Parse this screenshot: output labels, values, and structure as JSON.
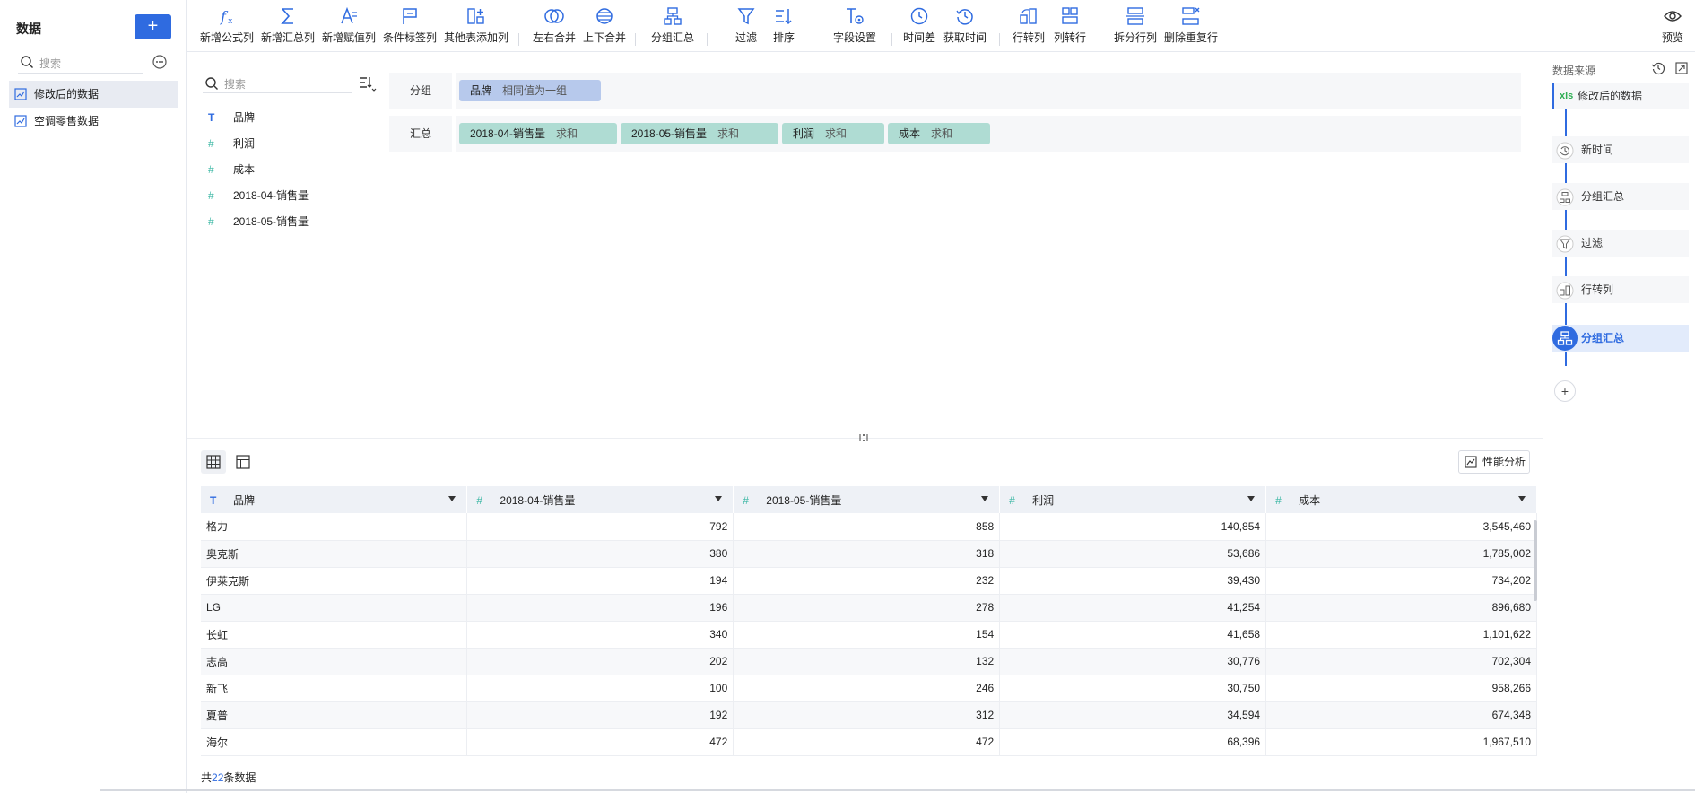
{
  "sidebar": {
    "title": "数据",
    "add_label": "+",
    "search_placeholder": "搜索",
    "items": [
      {
        "label": "修改后的数据",
        "active": true
      },
      {
        "label": "空调零售数据",
        "active": false
      }
    ]
  },
  "toolbar": {
    "buttons": [
      {
        "label": "新增公式列",
        "icon": "formula-icon"
      },
      {
        "label": "新增汇总列",
        "icon": "sigma-icon"
      },
      {
        "label": "新增赋值列",
        "icon": "assign-icon"
      },
      {
        "label": "条件标签列",
        "icon": "flag-icon"
      },
      {
        "label": "其他表添加列",
        "icon": "add-column-icon"
      },
      {
        "label": "左右合并",
        "icon": "merge-lr-icon"
      },
      {
        "label": "上下合并",
        "icon": "merge-ud-icon"
      },
      {
        "label": "分组汇总",
        "icon": "group-summary-icon"
      },
      {
        "label": "过滤",
        "icon": "filter-icon"
      },
      {
        "label": "排序",
        "icon": "sort-icon"
      },
      {
        "label": "字段设置",
        "icon": "field-settings-icon"
      },
      {
        "label": "时间差",
        "icon": "time-diff-icon"
      },
      {
        "label": "获取时间",
        "icon": "get-time-icon"
      },
      {
        "label": "行转列",
        "icon": "row-to-col-icon"
      },
      {
        "label": "列转行",
        "icon": "col-to-row-icon"
      },
      {
        "label": "拆分行列",
        "icon": "split-icon"
      },
      {
        "label": "删除重复行",
        "icon": "dedupe-icon"
      }
    ],
    "preview_label": "预览"
  },
  "fields": {
    "search_placeholder": "搜索",
    "items": [
      {
        "type": "T",
        "label": "品牌"
      },
      {
        "type": "#",
        "label": "利润"
      },
      {
        "type": "#",
        "label": "成本"
      },
      {
        "type": "#",
        "label": "2018-04-销售量"
      },
      {
        "type": "#",
        "label": "2018-05-销售量"
      }
    ]
  },
  "config": {
    "group_label": "分组",
    "group_chips": [
      {
        "field": "品牌",
        "mode": "相同值为一组"
      }
    ],
    "summary_label": "汇总",
    "summary_chips": [
      {
        "field": "2018-04-销售量",
        "mode": "求和"
      },
      {
        "field": "2018-05-销售量",
        "mode": "求和"
      },
      {
        "field": "利润",
        "mode": "求和"
      },
      {
        "field": "成本",
        "mode": "求和"
      }
    ]
  },
  "table": {
    "perf_label": "性能分析",
    "columns": [
      {
        "type": "T",
        "label": "品牌"
      },
      {
        "type": "#",
        "label": "2018-04-销售量"
      },
      {
        "type": "#",
        "label": "2018-05-销售量"
      },
      {
        "type": "#",
        "label": "利润"
      },
      {
        "type": "#",
        "label": "成本"
      }
    ],
    "rows": [
      [
        "格力",
        "792",
        "858",
        "140,854",
        "3,545,460"
      ],
      [
        "奥克斯",
        "380",
        "318",
        "53,686",
        "1,785,002"
      ],
      [
        "伊莱克斯",
        "194",
        "232",
        "39,430",
        "734,202"
      ],
      [
        "LG",
        "196",
        "278",
        "41,254",
        "896,680"
      ],
      [
        "长虹",
        "340",
        "154",
        "41,658",
        "1,101,622"
      ],
      [
        "志高",
        "202",
        "132",
        "30,776",
        "702,304"
      ],
      [
        "新飞",
        "100",
        "246",
        "30,750",
        "958,266"
      ],
      [
        "夏普",
        "192",
        "312",
        "34,594",
        "674,348"
      ],
      [
        "海尔",
        "472",
        "472",
        "68,396",
        "1,967,510"
      ]
    ],
    "count_prefix": "共",
    "count_value": "22",
    "count_suffix": "条数据"
  },
  "rpanel": {
    "title": "数据来源",
    "source": {
      "badge": "xls",
      "label": "修改后的数据"
    },
    "steps": [
      {
        "label": "新时间",
        "icon": "time-icon"
      },
      {
        "label": "分组汇总",
        "icon": "group-summary-icon"
      },
      {
        "label": "过滤",
        "icon": "filter-icon"
      },
      {
        "label": "行转列",
        "icon": "row-to-col-icon"
      },
      {
        "label": "分组汇总",
        "icon": "group-summary-icon",
        "active": true
      }
    ],
    "add_label": "+"
  },
  "colors": {
    "accent": "#2f6be0",
    "group_chip": "#b7c9ec",
    "summary_chip": "#afdcd3",
    "number_type": "#3bb7a4"
  }
}
